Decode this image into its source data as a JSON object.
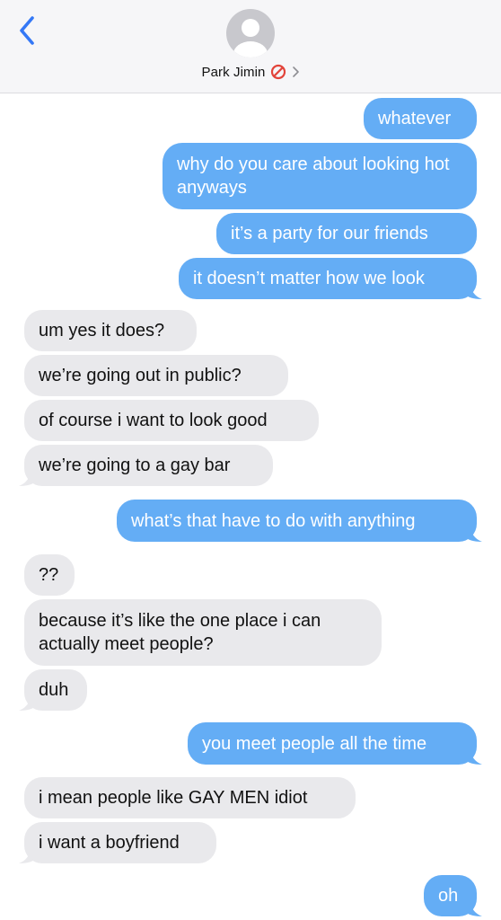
{
  "header": {
    "contact_name": "Park Jimin",
    "back_icon": "chevron-left-icon",
    "blocked_icon": "blocked-icon",
    "chevron_icon": "chevron-right-icon"
  },
  "colors": {
    "sent_bubble": "#64adf5",
    "received_bubble": "#e9e9ec",
    "accent": "#3478f6",
    "blocked": "#e2443a"
  },
  "messages": [
    {
      "direction": "sent",
      "text": "whatever"
    },
    {
      "direction": "sent",
      "text": "why do you care about looking hot anyways"
    },
    {
      "direction": "sent",
      "text": "it’s a party for our friends"
    },
    {
      "direction": "sent",
      "text": "it doesn’t matter how we look"
    },
    {
      "direction": "received",
      "text": "um yes it does?"
    },
    {
      "direction": "received",
      "text": "we’re going out in public?"
    },
    {
      "direction": "received",
      "text": "of course i want to look good"
    },
    {
      "direction": "received",
      "text": "we’re going to a gay bar"
    },
    {
      "direction": "sent",
      "text": "what’s that have to do with anything"
    },
    {
      "direction": "received",
      "text": "??"
    },
    {
      "direction": "received",
      "text": "because it’s like the one place i can actually meet people?"
    },
    {
      "direction": "received",
      "text": "duh"
    },
    {
      "direction": "sent",
      "text": "you meet people all the time"
    },
    {
      "direction": "received",
      "text": "i mean people like GAY MEN idiot"
    },
    {
      "direction": "received",
      "text": "i want a boyfriend"
    },
    {
      "direction": "sent",
      "text": "oh"
    }
  ]
}
